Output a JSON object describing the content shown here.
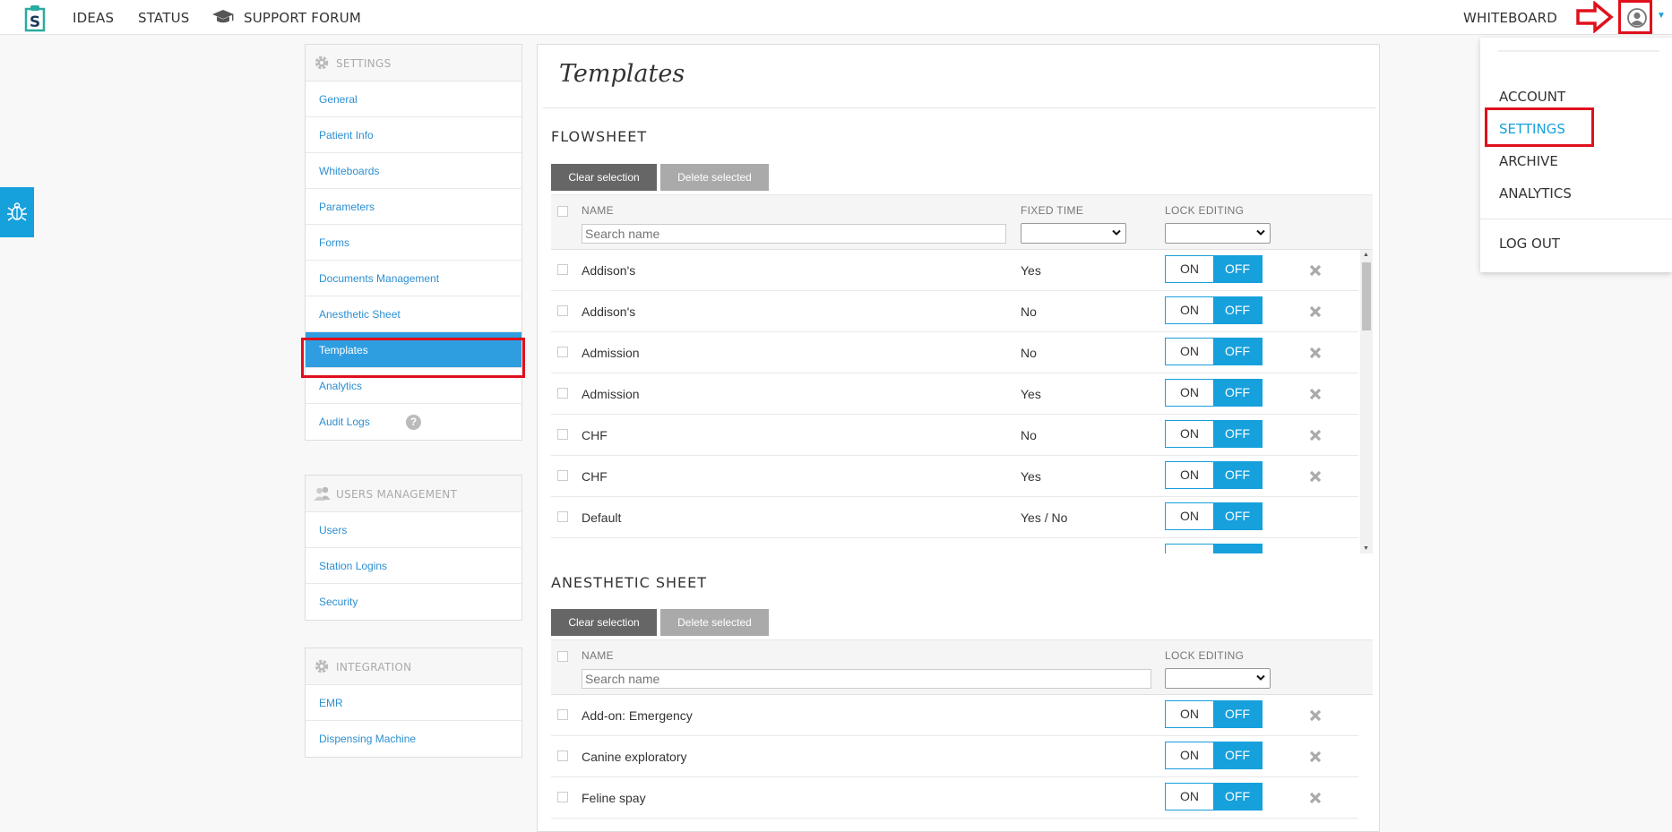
{
  "topnav": {
    "ideas": "IDEAS",
    "status": "STATUS",
    "support_forum": "SUPPORT FORUM",
    "whiteboard": "WHITEBOARD"
  },
  "user_menu": {
    "account": "ACCOUNT",
    "settings": "SETTINGS",
    "archive": "ARCHIVE",
    "analytics": "ANALYTICS",
    "logout": "LOG OUT"
  },
  "sidebar": {
    "settings": {
      "title": "SETTINGS",
      "items": [
        "General",
        "Patient Info",
        "Whiteboards",
        "Parameters",
        "Forms",
        "Documents Management",
        "Anesthetic Sheet",
        "Templates",
        "Analytics",
        "Audit Logs"
      ]
    },
    "users_management": {
      "title": "USERS MANAGEMENT",
      "items": [
        "Users",
        "Station Logins",
        "Security"
      ]
    },
    "integration": {
      "title": "INTEGRATION",
      "items": [
        "EMR",
        "Dispensing Machine"
      ]
    }
  },
  "main": {
    "title": "Templates",
    "flowsheet": {
      "title": "FLOWSHEET",
      "clear_label": "Clear selection",
      "delete_label": "Delete selected",
      "col_name": "NAME",
      "col_fixed": "FIXED TIME",
      "col_lock": "LOCK EDITING",
      "search_placeholder": "Search name",
      "rows": [
        {
          "name": "Addison's",
          "fixed": "Yes"
        },
        {
          "name": "Addison's",
          "fixed": "No"
        },
        {
          "name": "Admission",
          "fixed": "No"
        },
        {
          "name": "Admission",
          "fixed": "Yes"
        },
        {
          "name": "CHF",
          "fixed": "No"
        },
        {
          "name": "CHF",
          "fixed": "Yes"
        },
        {
          "name": "Default",
          "fixed": "Yes / No"
        }
      ]
    },
    "anesthetic": {
      "title": "ANESTHETIC SHEET",
      "clear_label": "Clear selection",
      "delete_label": "Delete selected",
      "col_name": "NAME",
      "col_lock": "LOCK EDITING",
      "search_placeholder": "Search name",
      "rows": [
        {
          "name": "Add-on: Emergency"
        },
        {
          "name": "Canine exploratory"
        },
        {
          "name": "Feline spay"
        }
      ]
    },
    "toggle": {
      "on": "ON",
      "off": "OFF"
    }
  },
  "colors": {
    "accent": "#16a0dc",
    "highlight": "#e0101c",
    "active": "#2f9ee0"
  }
}
